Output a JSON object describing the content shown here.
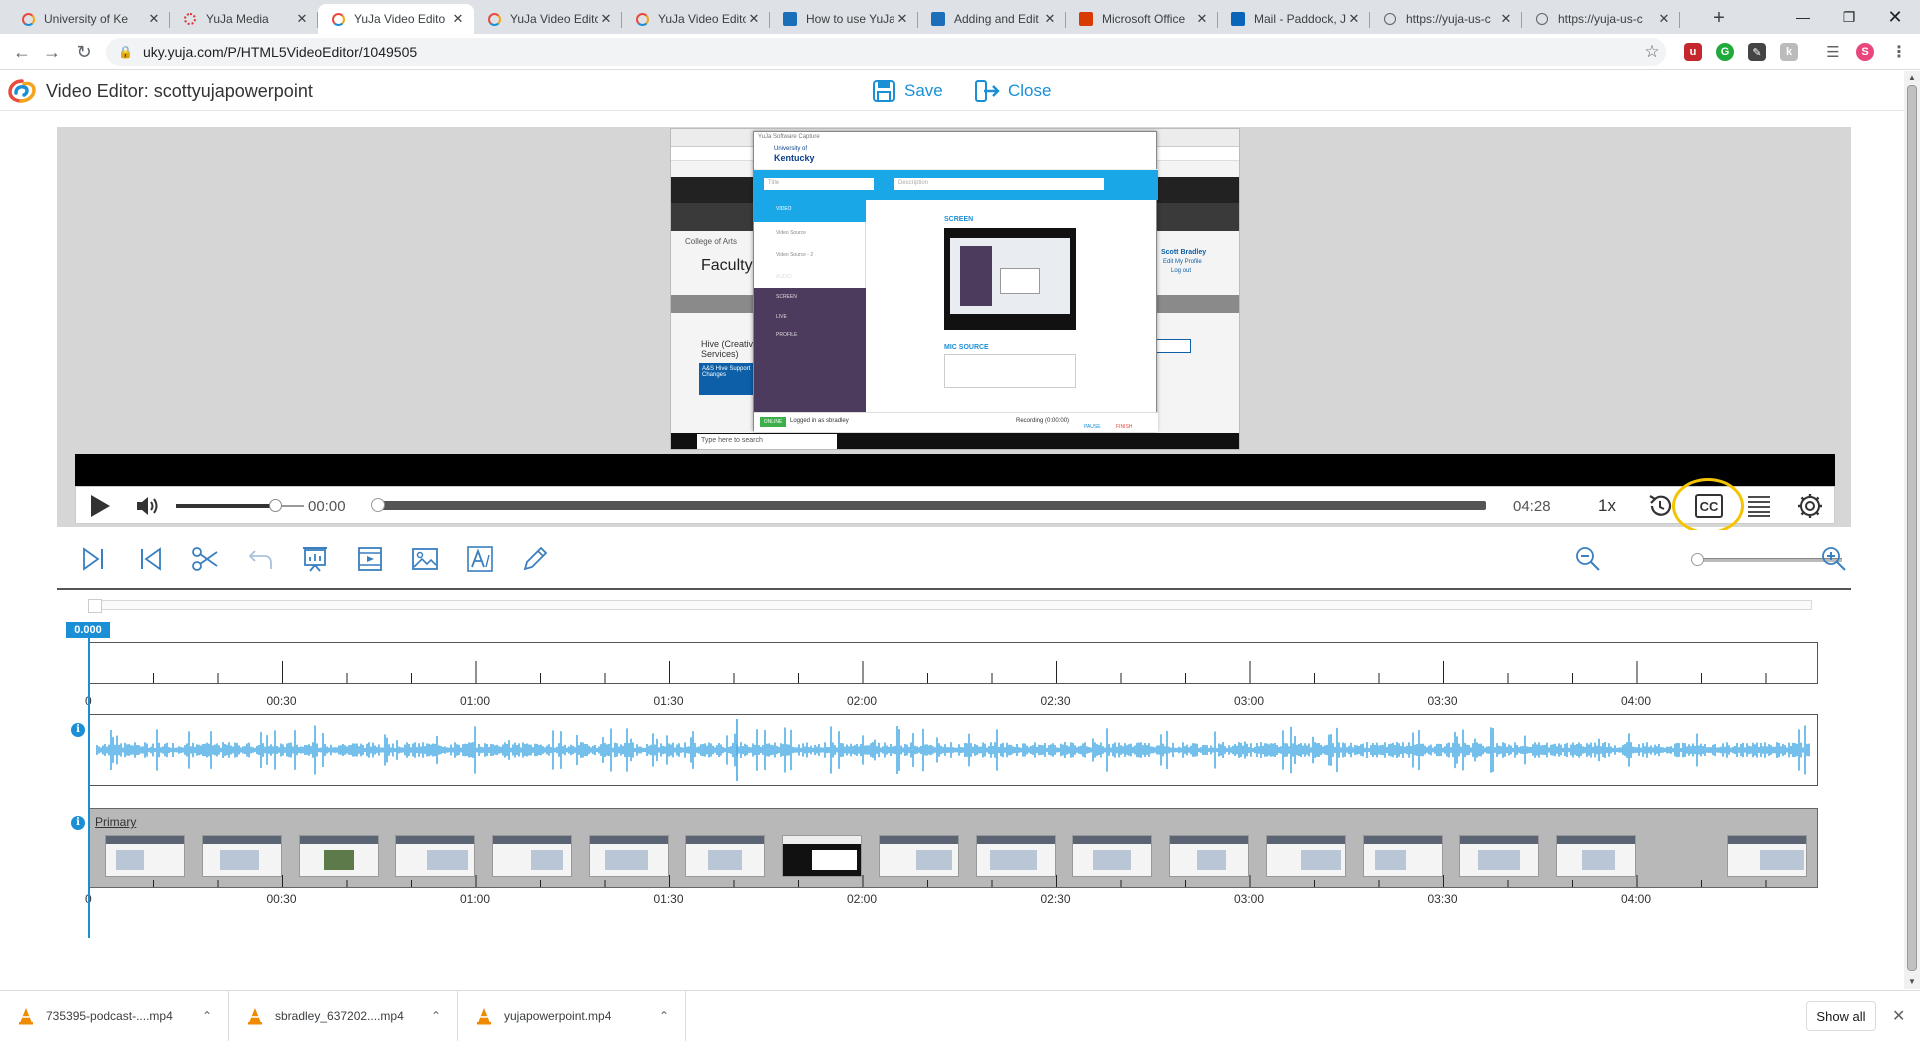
{
  "browser": {
    "tabs": [
      {
        "title": "University of Ke",
        "favicon": "yuja-icon",
        "active": false
      },
      {
        "title": "YuJa Media",
        "favicon": "loading-icon",
        "active": false
      },
      {
        "title": "YuJa Video Edito",
        "favicon": "yuja-icon",
        "active": true
      },
      {
        "title": "YuJa Video Edito",
        "favicon": "yuja-icon",
        "active": false
      },
      {
        "title": "YuJa Video Edito",
        "favicon": "yuja-icon",
        "active": false
      },
      {
        "title": "How to use YuJa",
        "favicon": "yuja-doc-icon",
        "active": false
      },
      {
        "title": "Adding and Edit",
        "favicon": "yuja-doc-icon",
        "active": false
      },
      {
        "title": "Microsoft Office",
        "favicon": "office-icon",
        "active": false
      },
      {
        "title": "Mail - Paddock, J",
        "favicon": "outlook-icon",
        "active": false
      },
      {
        "title": "https://yuja-us-c",
        "favicon": "globe-icon",
        "active": false
      },
      {
        "title": "https://yuja-us-c",
        "favicon": "globe-icon",
        "active": false
      }
    ],
    "url": "uky.yuja.com/P/HTML5VideoEditor/1049505",
    "profile_initial": "S"
  },
  "app": {
    "title": "Video Editor: scottyujapowerpoint",
    "save_label": "Save",
    "close_label": "Close",
    "brand_color": "#1a8fd6"
  },
  "player": {
    "current_time": "00:00",
    "duration": "04:28",
    "speed": "1x",
    "cc_label": "CC",
    "progress": 0.0,
    "volume": 0.7
  },
  "timeline": {
    "playhead": "0.000",
    "ticks": [
      "0",
      "00:30",
      "01:00",
      "01:30",
      "02:00",
      "02:30",
      "03:00",
      "03:30",
      "04:00"
    ],
    "track_label": "Primary"
  },
  "screen_content": {
    "app_name": "YuJa Software Capture",
    "university_line1": "University of",
    "university_line2": "Kentucky",
    "title_placeholder": "Title",
    "description_placeholder": "Description",
    "screen_label": "SCREEN",
    "mic_label": "MIC SOURCE",
    "sources": [
      "VIDEO",
      "Video Source",
      "Video Source - 2",
      "AUDIO",
      "SCREEN",
      "LIVE",
      "PROFILE"
    ],
    "status": "ONLINE",
    "logged_in": "Logged in as sbradley",
    "recording": "Recording (0:00:00)",
    "pause": "PAUSE",
    "finish": "FINISH",
    "bg_text_1": "College of Arts",
    "bg_text_2": "Faculty",
    "bg_text_3": "Hive (Creative Services)",
    "bg_text_4": "A&S Hive Support Changes",
    "bg_text_5": "Scott Bradley",
    "bg_text_6": "Edit My Profile",
    "bg_text_7": "Log out",
    "taskbar_search": "Type here to search"
  },
  "downloads": {
    "items": [
      "735395-podcast-....mp4",
      "sbradley_637202....mp4",
      "yujapowerpoint.mp4"
    ],
    "show_all": "Show all"
  }
}
